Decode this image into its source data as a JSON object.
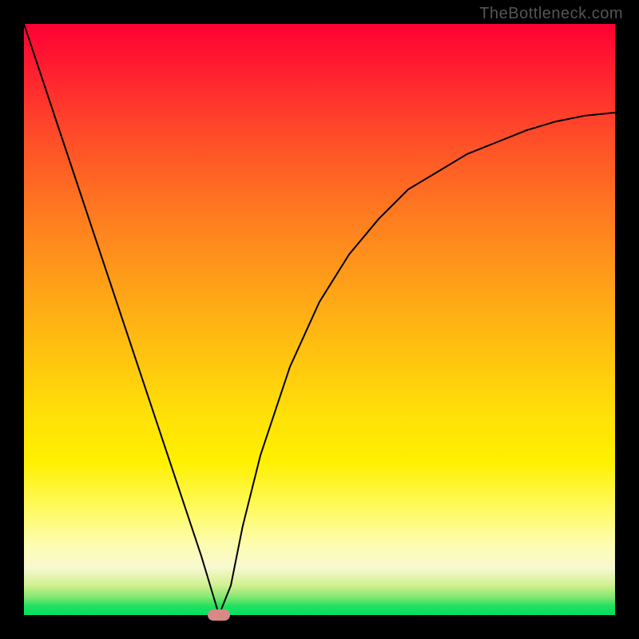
{
  "watermark": "TheBottleneck.com",
  "chart_data": {
    "type": "line",
    "title": "",
    "xlabel": "",
    "ylabel": "",
    "xlim": [
      0,
      100
    ],
    "ylim": [
      0,
      100
    ],
    "background_gradient": {
      "top_color": "#ff0033",
      "mid_color": "#ffe000",
      "bottom_color": "#00e060",
      "direction": "vertical"
    },
    "series": [
      {
        "name": "bottleneck-curve",
        "x": [
          0,
          5,
          10,
          15,
          20,
          25,
          30,
          33,
          35,
          37,
          40,
          45,
          50,
          55,
          60,
          65,
          70,
          75,
          80,
          85,
          90,
          95,
          100
        ],
        "y": [
          100,
          85,
          70,
          55,
          40,
          25,
          10,
          0,
          5,
          15,
          27,
          42,
          53,
          61,
          67,
          72,
          75,
          78,
          80,
          82,
          83.5,
          84.5,
          85
        ]
      }
    ],
    "marker": {
      "name": "optimal-point",
      "x": 33,
      "y": 0,
      "color": "#d98888"
    },
    "annotations": []
  }
}
